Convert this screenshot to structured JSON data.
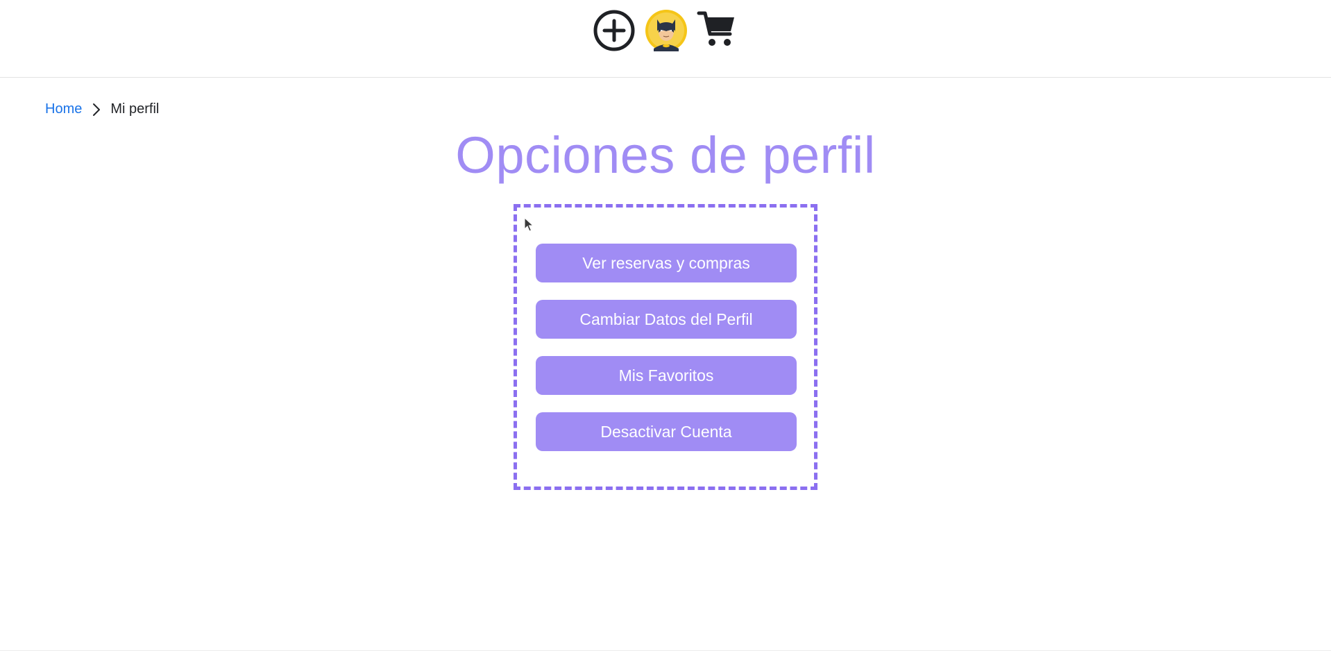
{
  "header": {
    "icons": {
      "add": "plus-circle-icon",
      "avatar": "batman-avatar-icon",
      "cart": "shopping-cart-icon"
    }
  },
  "breadcrumb": {
    "home_label": "Home",
    "separator_icon": "chevron-right-icon",
    "current_label": "Mi perfil"
  },
  "page": {
    "title": "Opciones de perfil"
  },
  "options": {
    "view_bookings_label": "Ver reservas y compras",
    "edit_profile_label": "Cambiar Datos del Perfil",
    "favorites_label": "Mis Favoritos",
    "deactivate_label": "Desactivar Cuenta"
  },
  "colors": {
    "accent": "#a08cf4",
    "accent_border": "#8b6ff0",
    "link": "#1a73e8",
    "text": "#222428",
    "avatar_bg": "#f5c518"
  }
}
